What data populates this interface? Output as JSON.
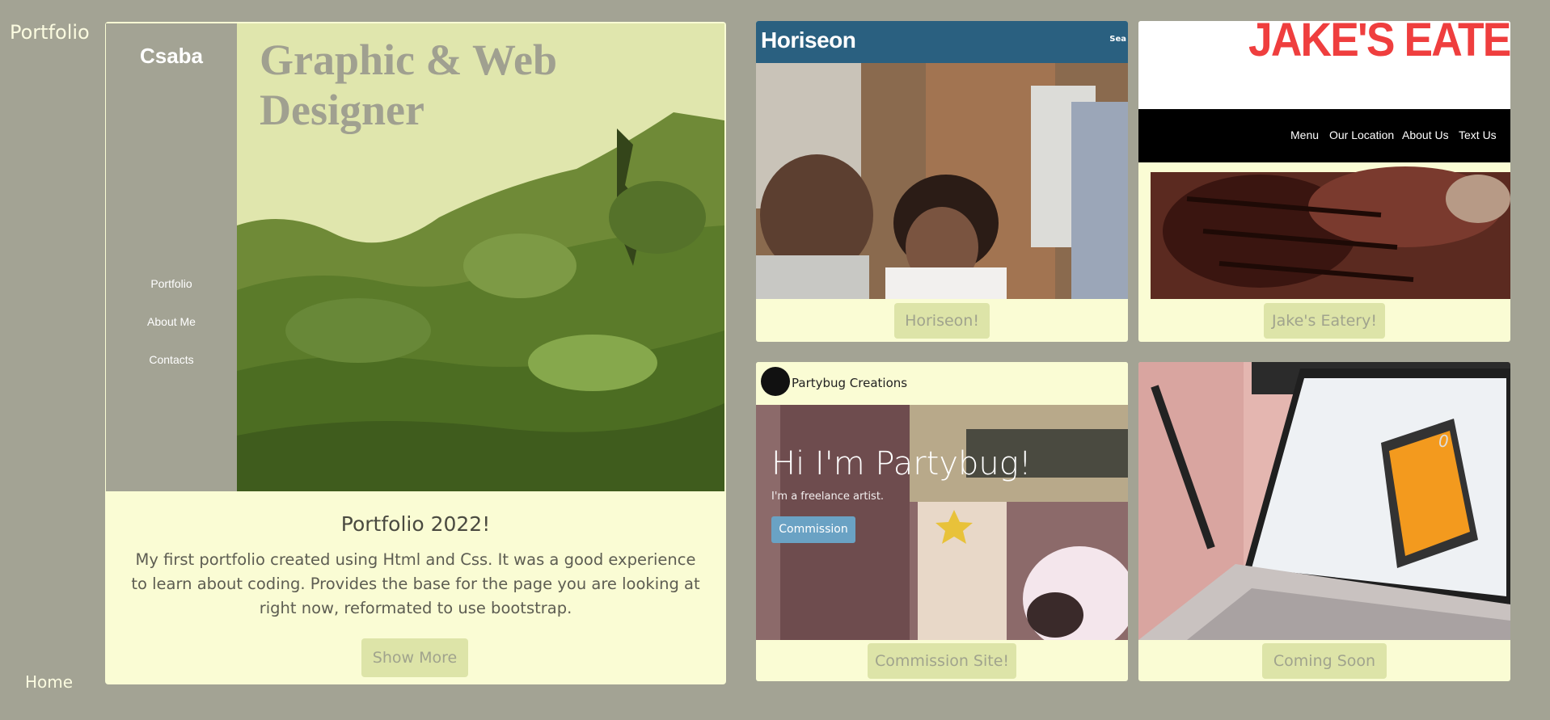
{
  "nav": {
    "brand": "Portfolio",
    "home": "Home"
  },
  "featured": {
    "site": {
      "logo": "Csaba",
      "title": "Graphic & Web Designer",
      "nav": [
        "Portfolio",
        "About Me",
        "Contacts"
      ]
    },
    "heading": "Portfolio 2022!",
    "description": "My first portfolio created using Html and Css. It was a good experience to learn about coding. Provides the base for the page you are looking at right now, reformated to use bootstrap.",
    "button": "Show More"
  },
  "projects": [
    {
      "id": "horiseon",
      "button": "Horiseon!",
      "preview": {
        "logo": "Horiseon",
        "search": "Sea"
      }
    },
    {
      "id": "jakes",
      "button": "Jake's Eatery!",
      "preview": {
        "logo": "JAKE'S EATERY",
        "nav": [
          "Menu",
          "Our Location",
          "About Us",
          "Text Us"
        ]
      }
    },
    {
      "id": "partybug",
      "button": "Commission Site!",
      "preview": {
        "brand": "Partybug Creations",
        "title": "Hi I'm Partybug!",
        "subtitle": "I'm a freelance artist.",
        "cta": "Commission"
      }
    },
    {
      "id": "coming-soon",
      "button": "Coming Soon",
      "preview": {
        "calc_display": "0"
      }
    }
  ],
  "colors": {
    "background": "#a3a394",
    "card": "#fafcd4",
    "button": "#dde4a8",
    "button_text": "#a0a38d"
  }
}
